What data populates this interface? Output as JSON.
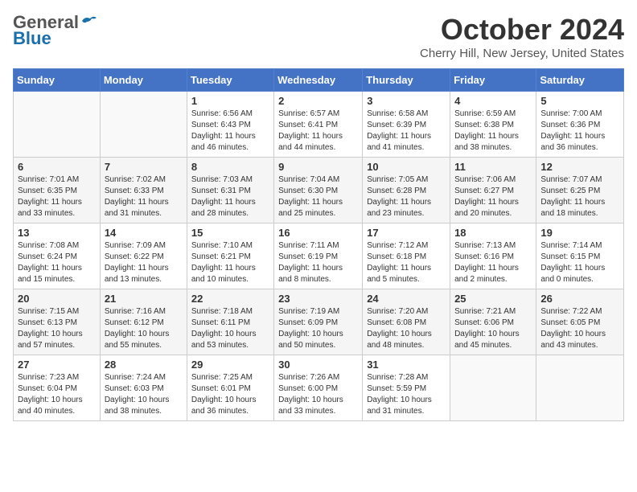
{
  "header": {
    "logo": {
      "general": "General",
      "blue": "Blue"
    },
    "title": "October 2024",
    "location": "Cherry Hill, New Jersey, United States"
  },
  "weekdays": [
    "Sunday",
    "Monday",
    "Tuesday",
    "Wednesday",
    "Thursday",
    "Friday",
    "Saturday"
  ],
  "weeks": [
    [
      {
        "day": "",
        "info": ""
      },
      {
        "day": "",
        "info": ""
      },
      {
        "day": "1",
        "info": "Sunrise: 6:56 AM\nSunset: 6:43 PM\nDaylight: 11 hours and 46 minutes."
      },
      {
        "day": "2",
        "info": "Sunrise: 6:57 AM\nSunset: 6:41 PM\nDaylight: 11 hours and 44 minutes."
      },
      {
        "day": "3",
        "info": "Sunrise: 6:58 AM\nSunset: 6:39 PM\nDaylight: 11 hours and 41 minutes."
      },
      {
        "day": "4",
        "info": "Sunrise: 6:59 AM\nSunset: 6:38 PM\nDaylight: 11 hours and 38 minutes."
      },
      {
        "day": "5",
        "info": "Sunrise: 7:00 AM\nSunset: 6:36 PM\nDaylight: 11 hours and 36 minutes."
      }
    ],
    [
      {
        "day": "6",
        "info": "Sunrise: 7:01 AM\nSunset: 6:35 PM\nDaylight: 11 hours and 33 minutes."
      },
      {
        "day": "7",
        "info": "Sunrise: 7:02 AM\nSunset: 6:33 PM\nDaylight: 11 hours and 31 minutes."
      },
      {
        "day": "8",
        "info": "Sunrise: 7:03 AM\nSunset: 6:31 PM\nDaylight: 11 hours and 28 minutes."
      },
      {
        "day": "9",
        "info": "Sunrise: 7:04 AM\nSunset: 6:30 PM\nDaylight: 11 hours and 25 minutes."
      },
      {
        "day": "10",
        "info": "Sunrise: 7:05 AM\nSunset: 6:28 PM\nDaylight: 11 hours and 23 minutes."
      },
      {
        "day": "11",
        "info": "Sunrise: 7:06 AM\nSunset: 6:27 PM\nDaylight: 11 hours and 20 minutes."
      },
      {
        "day": "12",
        "info": "Sunrise: 7:07 AM\nSunset: 6:25 PM\nDaylight: 11 hours and 18 minutes."
      }
    ],
    [
      {
        "day": "13",
        "info": "Sunrise: 7:08 AM\nSunset: 6:24 PM\nDaylight: 11 hours and 15 minutes."
      },
      {
        "day": "14",
        "info": "Sunrise: 7:09 AM\nSunset: 6:22 PM\nDaylight: 11 hours and 13 minutes."
      },
      {
        "day": "15",
        "info": "Sunrise: 7:10 AM\nSunset: 6:21 PM\nDaylight: 11 hours and 10 minutes."
      },
      {
        "day": "16",
        "info": "Sunrise: 7:11 AM\nSunset: 6:19 PM\nDaylight: 11 hours and 8 minutes."
      },
      {
        "day": "17",
        "info": "Sunrise: 7:12 AM\nSunset: 6:18 PM\nDaylight: 11 hours and 5 minutes."
      },
      {
        "day": "18",
        "info": "Sunrise: 7:13 AM\nSunset: 6:16 PM\nDaylight: 11 hours and 2 minutes."
      },
      {
        "day": "19",
        "info": "Sunrise: 7:14 AM\nSunset: 6:15 PM\nDaylight: 11 hours and 0 minutes."
      }
    ],
    [
      {
        "day": "20",
        "info": "Sunrise: 7:15 AM\nSunset: 6:13 PM\nDaylight: 10 hours and 57 minutes."
      },
      {
        "day": "21",
        "info": "Sunrise: 7:16 AM\nSunset: 6:12 PM\nDaylight: 10 hours and 55 minutes."
      },
      {
        "day": "22",
        "info": "Sunrise: 7:18 AM\nSunset: 6:11 PM\nDaylight: 10 hours and 53 minutes."
      },
      {
        "day": "23",
        "info": "Sunrise: 7:19 AM\nSunset: 6:09 PM\nDaylight: 10 hours and 50 minutes."
      },
      {
        "day": "24",
        "info": "Sunrise: 7:20 AM\nSunset: 6:08 PM\nDaylight: 10 hours and 48 minutes."
      },
      {
        "day": "25",
        "info": "Sunrise: 7:21 AM\nSunset: 6:06 PM\nDaylight: 10 hours and 45 minutes."
      },
      {
        "day": "26",
        "info": "Sunrise: 7:22 AM\nSunset: 6:05 PM\nDaylight: 10 hours and 43 minutes."
      }
    ],
    [
      {
        "day": "27",
        "info": "Sunrise: 7:23 AM\nSunset: 6:04 PM\nDaylight: 10 hours and 40 minutes."
      },
      {
        "day": "28",
        "info": "Sunrise: 7:24 AM\nSunset: 6:03 PM\nDaylight: 10 hours and 38 minutes."
      },
      {
        "day": "29",
        "info": "Sunrise: 7:25 AM\nSunset: 6:01 PM\nDaylight: 10 hours and 36 minutes."
      },
      {
        "day": "30",
        "info": "Sunrise: 7:26 AM\nSunset: 6:00 PM\nDaylight: 10 hours and 33 minutes."
      },
      {
        "day": "31",
        "info": "Sunrise: 7:28 AM\nSunset: 5:59 PM\nDaylight: 10 hours and 31 minutes."
      },
      {
        "day": "",
        "info": ""
      },
      {
        "day": "",
        "info": ""
      }
    ]
  ]
}
